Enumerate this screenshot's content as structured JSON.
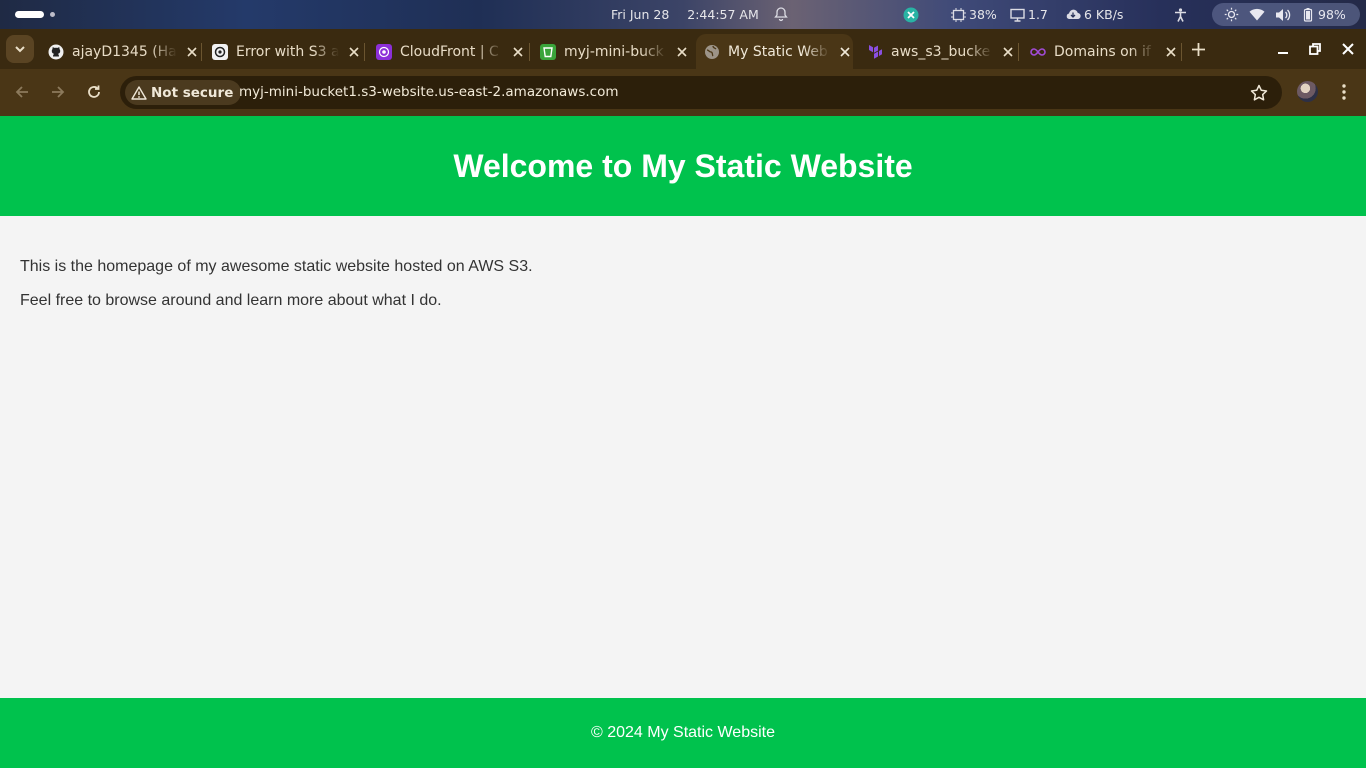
{
  "system_bar": {
    "date": "Fri Jun 28",
    "time": "2:44:57 AM",
    "cpu": "38%",
    "load": "1.7",
    "network": "6 KB/s",
    "battery": "98%"
  },
  "tabs": [
    {
      "title": "ajayD1345 (Ha",
      "favicon": "github-icon",
      "active": false
    },
    {
      "title": "Error with S3 a",
      "favicon": "chatgpt-icon",
      "active": false
    },
    {
      "title": "CloudFront | C",
      "favicon": "cloudfront-icon",
      "active": false
    },
    {
      "title": "myj-mini-buck",
      "favicon": "s3-bucket-icon",
      "active": false
    },
    {
      "title": "My Static Web",
      "favicon": "globe-icon",
      "active": true
    },
    {
      "title": "aws_s3_bucke",
      "favicon": "terraform-icon",
      "active": false
    },
    {
      "title": "Domains on if",
      "favicon": "infinityfree-icon",
      "active": false
    }
  ],
  "toolbar": {
    "security_label": "Not secure",
    "url": "myj-mini-bucket1.s3-website.us-east-2.amazonaws.com"
  },
  "page": {
    "header_title": "Welcome to My Static Website",
    "paragraphs": [
      "This is the homepage of my awesome static website hosted on AWS S3.",
      "Feel free to browse around and learn more about what I do."
    ],
    "footer": "© 2024 My Static Website",
    "colors": {
      "accent": "#00c24d",
      "background": "#f4f4f4",
      "text": "#333333"
    }
  },
  "theme": {
    "tabstrip": "#3a2a10",
    "toolbar": "#4a3616"
  }
}
